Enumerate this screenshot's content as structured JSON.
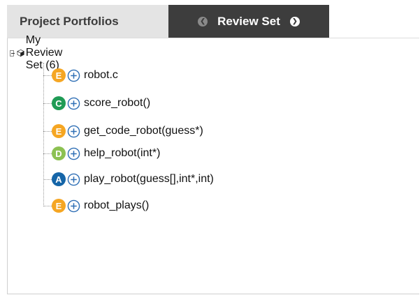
{
  "tabs": {
    "portfolios_label": "Project Portfolios",
    "review_label": "Review Set"
  },
  "tree": {
    "root_label": "My Review Set (6)",
    "items": [
      {
        "grade": "E",
        "color": "#f5a623",
        "label": "robot.c"
      },
      {
        "grade": "C",
        "color": "#1f9b55",
        "label": "score_robot()"
      },
      {
        "grade": "E",
        "color": "#f5a623",
        "label": "get_code_robot(guess*)"
      },
      {
        "grade": "D",
        "color": "#8cc152",
        "label": "help_robot(int*)"
      },
      {
        "grade": "A",
        "color": "#1565a8",
        "label": "play_robot(guess[],int*,int)"
      },
      {
        "grade": "E",
        "color": "#f5a623",
        "label": "robot_plays()"
      }
    ]
  },
  "colors": {
    "active_tab_bg": "#3d3d3d",
    "inactive_tab_bg": "#e4e4e4",
    "plus_icon": "#2f6fb5"
  }
}
